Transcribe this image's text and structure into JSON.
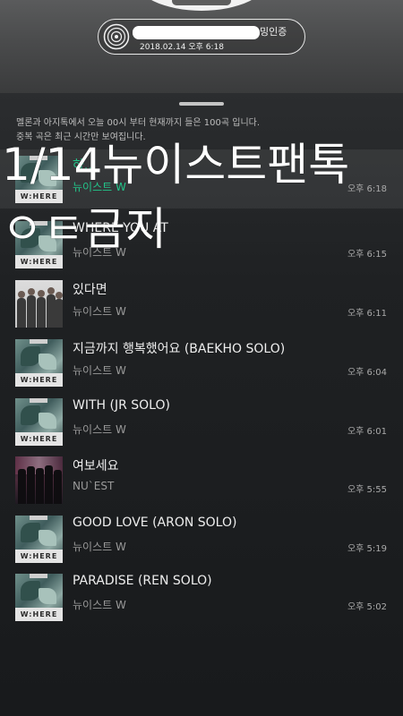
{
  "header": {
    "pill_suffix": "밍인증",
    "pill_date": "2018.02.14 오후 6:18"
  },
  "notice": {
    "line1": "멜론과 아지톡에서 오늘 00시 부터 현재까지 들은 100곡 입니다.",
    "line2": "중복 곡은 최근 시간만 보여집니다."
  },
  "overlay": {
    "line1": "1/14뉴이스트팬톡",
    "line2": "ㅇㅌ금지"
  },
  "tracks": [
    {
      "title": "하...",
      "artist": "뉴이스트 W",
      "time": "오후 6:18"
    },
    {
      "title": "WHERE YOU AT",
      "artist": "뉴이스트 W",
      "time": "오후 6:15"
    },
    {
      "title": "있다면",
      "artist": "뉴이스트 W",
      "time": "오후 6:11"
    },
    {
      "title": "지금까지 행복했어요 (BAEKHO SOLO)",
      "artist": "뉴이스트 W",
      "time": "오후 6:04"
    },
    {
      "title": "WITH (JR SOLO)",
      "artist": "뉴이스트 W",
      "time": "오후 6:01"
    },
    {
      "title": "여보세요",
      "artist": "NU`EST",
      "time": "오후 5:55"
    },
    {
      "title": "GOOD LOVE (ARON SOLO)",
      "artist": "뉴이스트 W",
      "time": "오후 5:19"
    },
    {
      "title": "PARADISE (REN SOLO)",
      "artist": "뉴이스트 W",
      "time": "오후 5:02"
    }
  ],
  "album_art_text": "W:HERE",
  "colors": {
    "accent": "#22c58a",
    "background": "#16181a"
  },
  "icons": {
    "pill_icon": "vinyl-record-icon"
  }
}
